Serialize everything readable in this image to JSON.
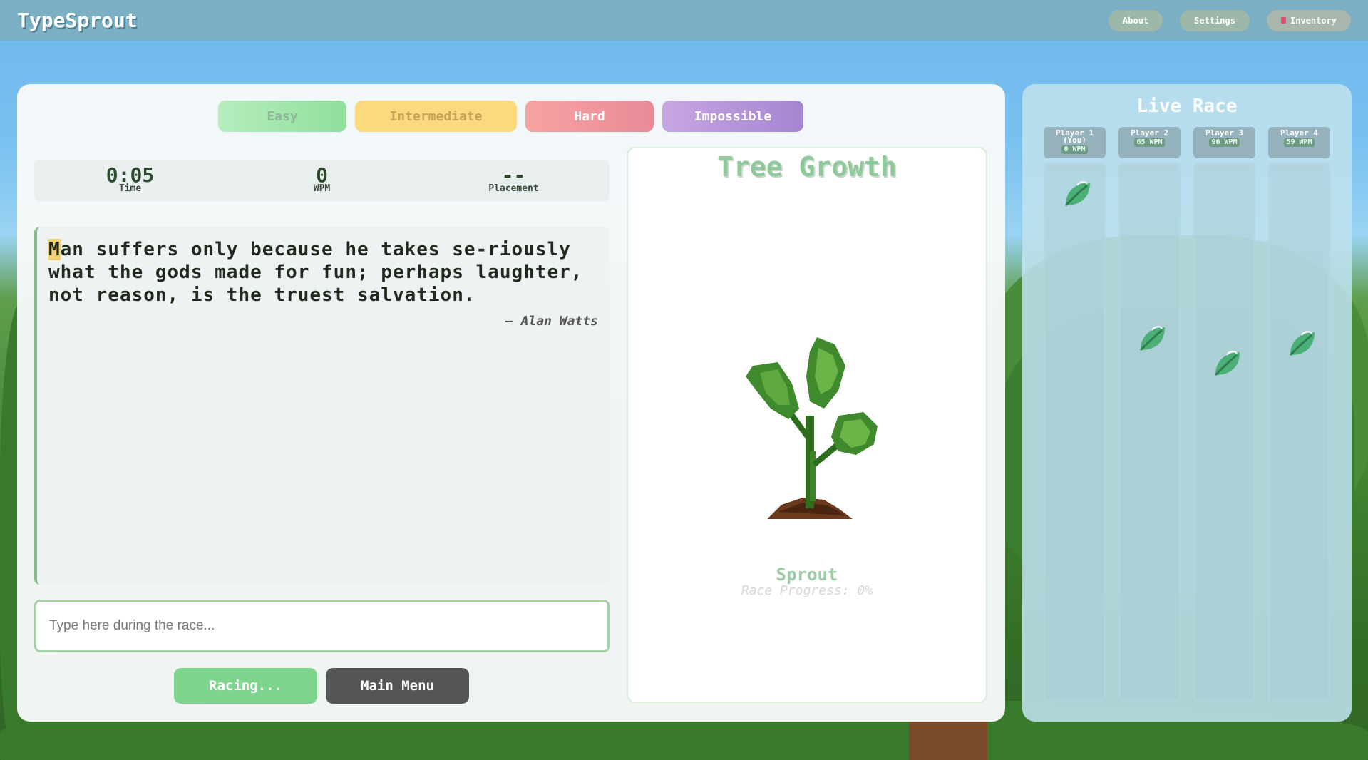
{
  "app": {
    "title": "TypeSprout"
  },
  "nav": [
    {
      "label": "About",
      "icon": ""
    },
    {
      "label": "Settings",
      "icon": ""
    },
    {
      "label": "Inventory",
      "icon": "bag-icon"
    }
  ],
  "difficulty": {
    "options": [
      "Easy",
      "Intermediate",
      "Hard",
      "Impossible"
    ],
    "selected": "Easy"
  },
  "stats": {
    "time": {
      "value": "0:05",
      "label": "Time"
    },
    "wpm": {
      "value": "0",
      "label": "WPM"
    },
    "placement": {
      "value": "--",
      "label": "Placement"
    }
  },
  "quote": {
    "first_char": "M",
    "rest": "an suffers only because he takes se-riously what the gods made for fun; perhaps laughter, not reason, is the truest salvation.",
    "author": "— Alan Watts"
  },
  "input": {
    "placeholder": "Type here during the race...",
    "value": ""
  },
  "buttons": {
    "racing": "Racing...",
    "main_menu": "Main Menu"
  },
  "tree": {
    "title": "Tree Growth",
    "stage": "Sprout",
    "progress_text": "Race Progress: 0%",
    "progress": 0
  },
  "race": {
    "title": "Live Race",
    "players": [
      {
        "name": "Player 1 (You)",
        "wpm": "0 WPM",
        "progress": 0.02
      },
      {
        "name": "Player 2",
        "wpm": "65 WPM",
        "progress": 0.31
      },
      {
        "name": "Player 3",
        "wpm": "96 WPM",
        "progress": 0.36
      },
      {
        "name": "Player 4",
        "wpm": "59 WPM",
        "progress": 0.32
      }
    ]
  },
  "colors": {
    "accent_green": "#7ed48c",
    "topbar": "#7aafc4",
    "easy": "#8fdf9b",
    "intermediate": "#fbd97e",
    "hard": "#ea8a98",
    "impossible": "#a585d0"
  }
}
